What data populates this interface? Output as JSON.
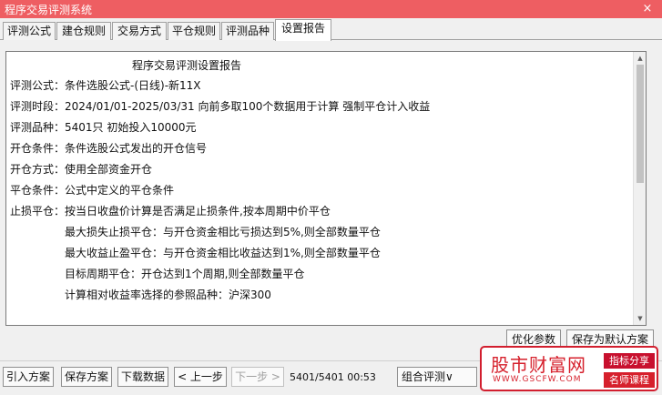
{
  "window": {
    "title": "程序交易评测系统",
    "close_label": "×"
  },
  "tabs": [
    {
      "label": "评测公式"
    },
    {
      "label": "建仓规则"
    },
    {
      "label": "交易方式"
    },
    {
      "label": "平仓规则"
    },
    {
      "label": "评测品种"
    },
    {
      "label": "设置报告"
    }
  ],
  "report": {
    "title": "程序交易评测设置报告",
    "lines": [
      "评测公式：条件选股公式-(日线)-新11X",
      "评测时段：2024/01/01-2025/03/31 向前多取100个数据用于计算 强制平仓计入收益",
      "评测品种：5401只 初始投入10000元",
      "开仓条件：条件选股公式发出的开仓信号",
      "开仓方式：使用全部资金开仓",
      "平仓条件：公式中定义的平仓条件",
      "止损平仓：按当日收盘价计算是否满足止损条件,按本周期中价平仓",
      "最大损失止损平仓：与开仓资金相比亏损达到5%,则全部数量平仓",
      "最大收益止盈平仓：与开仓资金相比收益达到1%,则全部数量平仓",
      "目标周期平仓：开仓达到1个周期,则全部数量平仓",
      "计算相对收益率选择的参照品种：沪深300"
    ]
  },
  "side_buttons": {
    "optimize": "优化参数",
    "save_default": "保存为默认方案"
  },
  "bottom": {
    "import": "引入方案",
    "save": "保存方案",
    "download": "下载数据",
    "prev": "< 上一步",
    "next": "下一步 >",
    "status": "5401/5401 00:53",
    "combo": "组合评测∨"
  },
  "watermark": {
    "main": "股市财富网",
    "url": "WWW.GSCFW.COM",
    "tag1": "指标分享",
    "tag2": "名师课程"
  },
  "colors": {
    "titlebar": "#ee5e62",
    "watermark_red": "#d6202c"
  }
}
